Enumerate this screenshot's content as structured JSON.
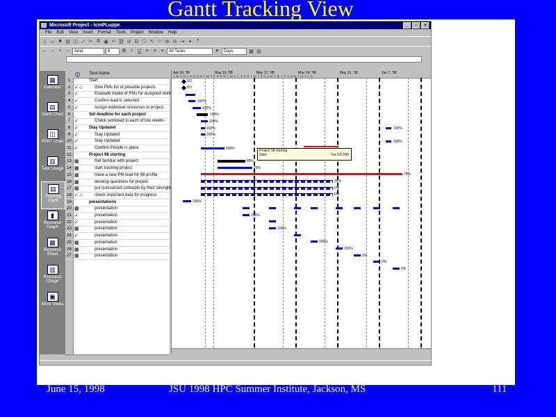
{
  "slide": {
    "title": "Gantt Tracking View",
    "footer_left": "June 15,  1998",
    "footer_center": "JSU 1998 HPC Summer Institute, Jackson, MS",
    "footer_right": "111"
  },
  "window": {
    "title": "Microsoft Project - tcmPLuppe",
    "menus": [
      "File",
      "Edit",
      "View",
      "Insert",
      "Format",
      "Tools",
      "Project",
      "Window",
      "Help"
    ],
    "font_box": "Arial",
    "size_box": "8",
    "filter_box": "All Tasks",
    "group_box": "Days"
  },
  "views": [
    "Calendar",
    "Gantt Chart",
    "PERT Chart",
    "Task Usage",
    "Tracking Gantt",
    "Resource Graph",
    "Resource Sheet",
    "Resource Usage",
    "More Views"
  ],
  "table": {
    "header_info": "ⓘ",
    "header_name": "Task Name"
  },
  "tasks": [
    {
      "id": "1",
      "ind": "",
      "name": "Start"
    },
    {
      "id": "2",
      "ind": "✓☺",
      "name": "Give PMs list of possible projects"
    },
    {
      "id": "3",
      "ind": "✓",
      "name": "Evaluate intake of PMs for assigned work"
    },
    {
      "id": "4",
      "ind": "✓",
      "name": "Confirm lead is selected"
    },
    {
      "id": "5",
      "ind": "✓",
      "name": "Assign individual resources to project"
    },
    {
      "id": "6",
      "ind": "",
      "name": "Set deadline for each project"
    },
    {
      "id": "7",
      "ind": "✓",
      "name": "Check workload in each of two weeks"
    },
    {
      "id": "8",
      "ind": "✓",
      "name": "Stay Updated"
    },
    {
      "id": "9",
      "ind": "✓",
      "name": "Stay Updated"
    },
    {
      "id": "10",
      "ind": "✓",
      "name": "Stay Updated"
    },
    {
      "id": "11",
      "ind": "✓",
      "name": "Confirm People in place"
    },
    {
      "id": "12",
      "ind": "",
      "name": "Project 98 starting"
    },
    {
      "id": "13",
      "ind": "▦",
      "name": "Get familiar with project"
    },
    {
      "id": "14",
      "ind": "▦",
      "name": "start tracking project"
    },
    {
      "id": "15",
      "ind": "▦",
      "name": "Have a new PM lead for 98 profile"
    },
    {
      "id": "16",
      "ind": "▦",
      "name": "develop questions for project"
    },
    {
      "id": "17",
      "ind": "▦",
      "name": "put outsourced concepts by their strength"
    },
    {
      "id": "18",
      "ind": "✓☺",
      "name": "check important data for progress"
    },
    {
      "id": "19",
      "ind": "",
      "name": "presentations"
    },
    {
      "id": "20",
      "ind": "▦",
      "name": "presentation"
    },
    {
      "id": "21",
      "ind": "✓",
      "name": "presentation"
    },
    {
      "id": "22",
      "ind": "✓",
      "name": "presentation"
    },
    {
      "id": "23",
      "ind": "▦",
      "name": "presentation"
    },
    {
      "id": "24",
      "ind": "✓",
      "name": "presentation"
    },
    {
      "id": "25",
      "ind": "▦",
      "name": "presentation"
    },
    {
      "id": "26",
      "ind": "▦",
      "name": "presentation"
    },
    {
      "id": "27",
      "ind": "▦",
      "name": "presentation"
    }
  ],
  "gantt": {
    "weeks": [
      "Apr 26, '98",
      "May 10, '98",
      "May 17, '98",
      "May 24, '98",
      "May 31, '98",
      "Jun 7, '98"
    ],
    "day_letters": "SMTWTFSSMTWTFSSMTWTFSSMTWTFSSMTWTFSSMTWTFS",
    "labels": {
      "l1": "5/3",
      "l2": "5/3",
      "l4": "100%",
      "l5": "100%",
      "l6": "100%",
      "l7": "100%",
      "l8": "100%",
      "l9": "100%",
      "l11": "100%",
      "l13": "89%",
      "l14": "79%",
      "l15": "78%",
      "l16": "25%",
      "l17": "0%",
      "l18": "0%",
      "l19": "100%",
      "l8b": "100%",
      "l10b": "100%"
    },
    "popup": {
      "name": "Project 98 starting",
      "start_label": "Start:",
      "start_value": "Tue 5/12/98",
      "finish_label": "Finish:",
      "finish_value": "Wed 5/20/98"
    },
    "presentation_labels": [
      "100%",
      "100%",
      "100%",
      "100%",
      "100%",
      "0%",
      "0%",
      "0%"
    ]
  }
}
